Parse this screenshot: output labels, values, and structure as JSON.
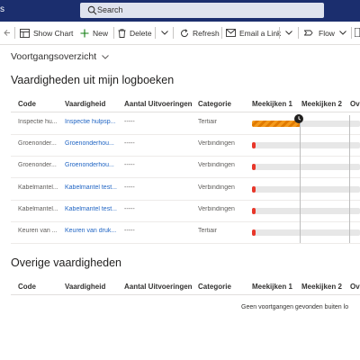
{
  "topbar": {
    "app_name": "s",
    "search_placeholder": "Search"
  },
  "cmdbar": {
    "show_chart": "Show Chart",
    "new": "New",
    "delete": "Delete",
    "refresh": "Refresh",
    "email_link": "Email a Link",
    "flow": "Flow"
  },
  "section_title": "Voortgangsoverzicht",
  "table1": {
    "title": "Vaardigheden uit mijn logboeken",
    "headers": [
      "Code",
      "Vaardigheid",
      "Aantal Uitvoeringen",
      "Categorie",
      "Meekijken 1",
      "Meekijken 2",
      "Ov"
    ],
    "rows": [
      {
        "code": "Inspectie hu...",
        "skill": "Inspectie hulpsp...",
        "count": "-----",
        "category": "Tertiair",
        "progress": 0.45,
        "style": "striped"
      },
      {
        "code": "Groenonder...",
        "skill": "Groenonderhou...",
        "count": "-----",
        "category": "Verbindingen",
        "progress": 0.03,
        "style": "red"
      },
      {
        "code": "Groenonder...",
        "skill": "Groenonderhou...",
        "count": "-----",
        "category": "Verbindingen",
        "progress": 0.03,
        "style": "red"
      },
      {
        "code": "Kabelmantel...",
        "skill": "Kabelmantel test...",
        "count": "-----",
        "category": "Verbindingen",
        "progress": 0.03,
        "style": "red"
      },
      {
        "code": "Kabelmantel...",
        "skill": "Kabelmantel test...",
        "count": "-----",
        "category": "Verbindingen",
        "progress": 0.03,
        "style": "red"
      },
      {
        "code": "Keuren van ...",
        "skill": "Keuren van druk...",
        "count": "-----",
        "category": "Tertiair",
        "progress": 0.03,
        "style": "red"
      }
    ]
  },
  "table2": {
    "title": "Overige vaardigheden",
    "headers": [
      "Code",
      "Vaardigheid",
      "Aantal Uitvoeringen",
      "Categorie",
      "Meekijken 1",
      "Meekijken 2",
      "Ov"
    ],
    "empty_message": "Geen voortgangen gevonden buiten lo"
  },
  "colors": {
    "topbar": "#1b2e6e",
    "link": "#2266c4",
    "red": "#e8372a",
    "orange": "#f49a1c"
  }
}
